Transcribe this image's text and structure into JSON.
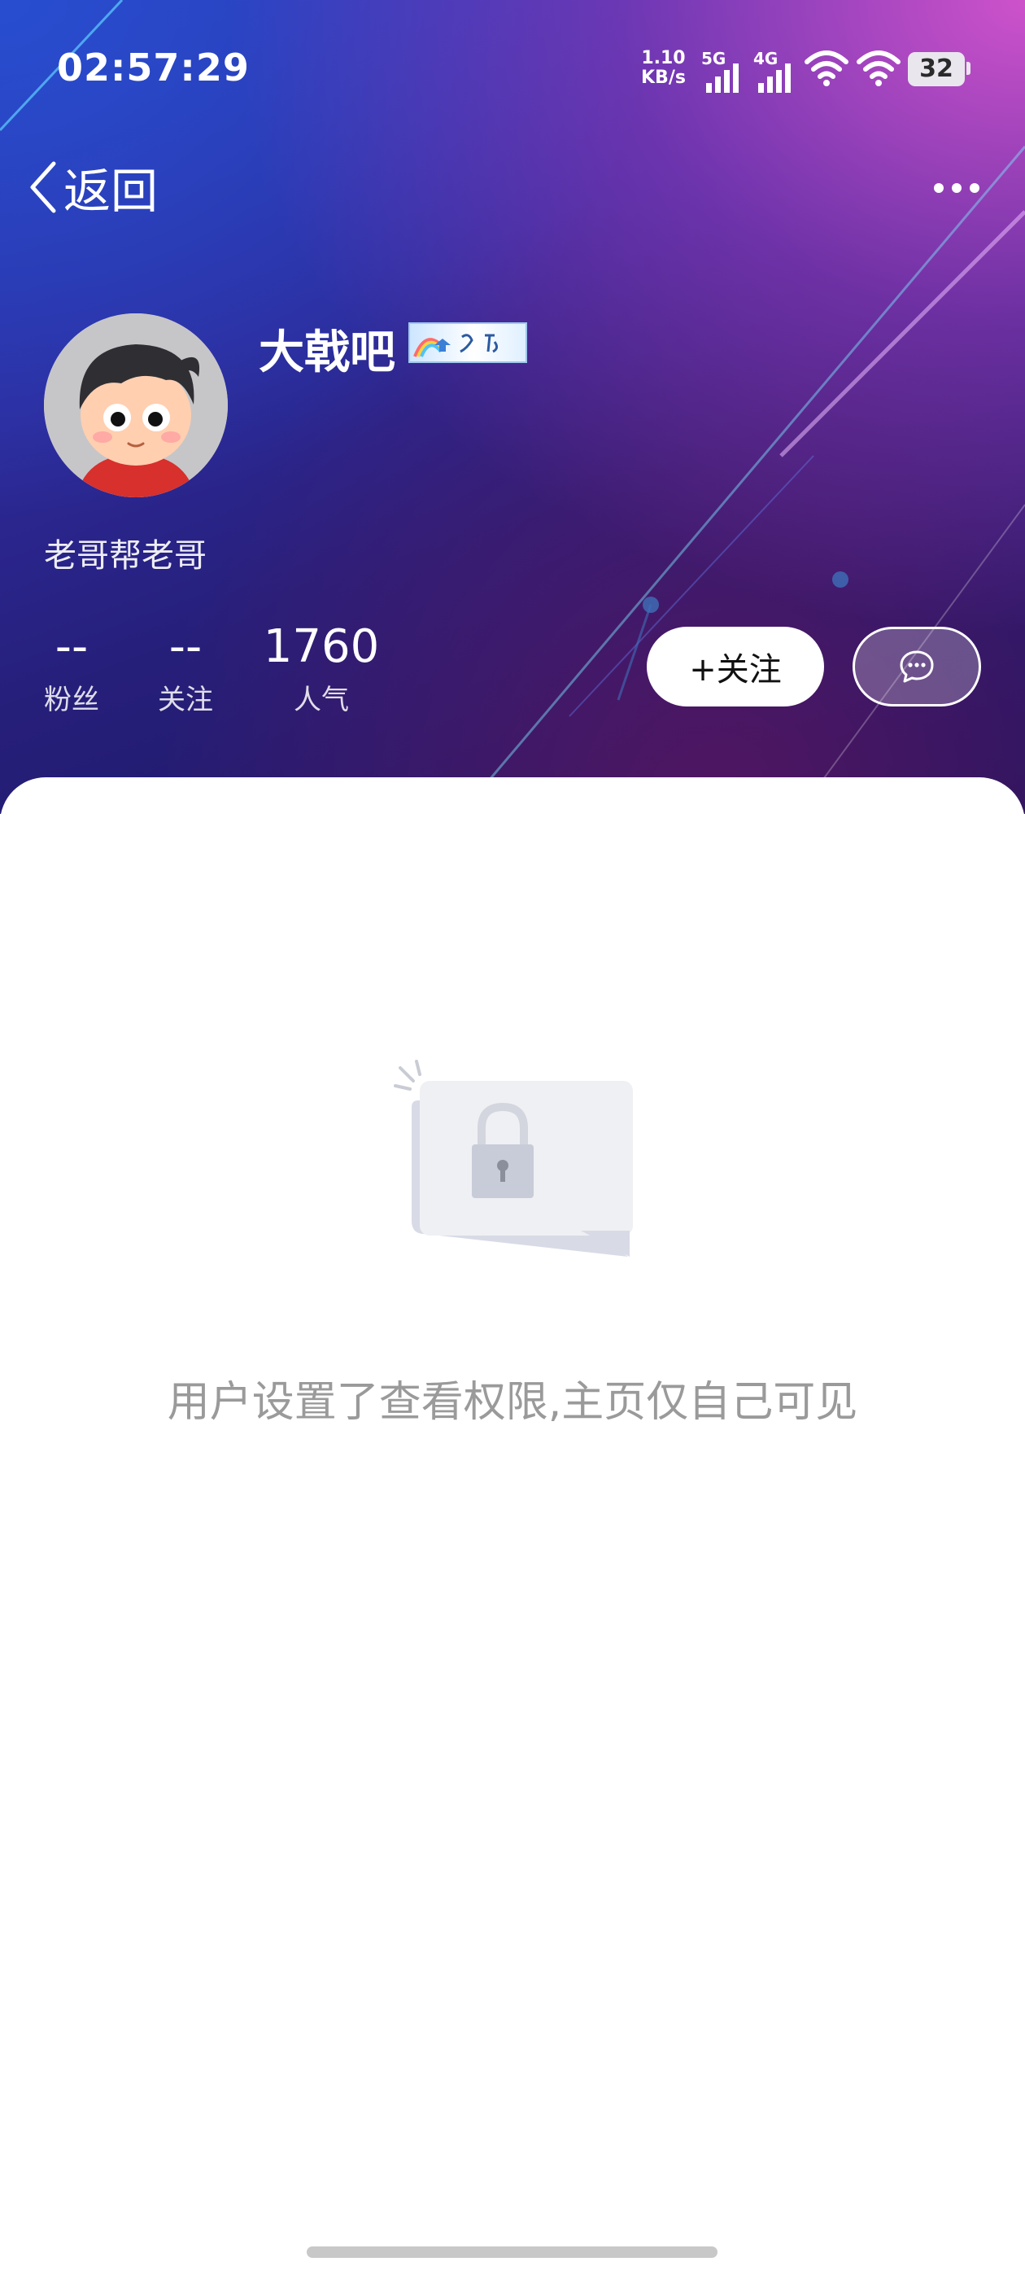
{
  "status_bar": {
    "time": "02:57:29",
    "net_speed_value": "1.10",
    "net_speed_unit": "KB/s",
    "signal1_label": "5G",
    "signal2_label": "4G",
    "battery": "32"
  },
  "nav": {
    "back_label": "返回"
  },
  "profile": {
    "nickname": "大戟吧",
    "bio": "老哥帮老哥",
    "stats": [
      {
        "value": "--",
        "label": "粉丝"
      },
      {
        "value": "--",
        "label": "关注"
      },
      {
        "value": "1760",
        "label": "人气"
      }
    ],
    "follow_label": "+关注"
  },
  "empty_state": {
    "message": "用户设置了查看权限,主页仅自己可见"
  }
}
